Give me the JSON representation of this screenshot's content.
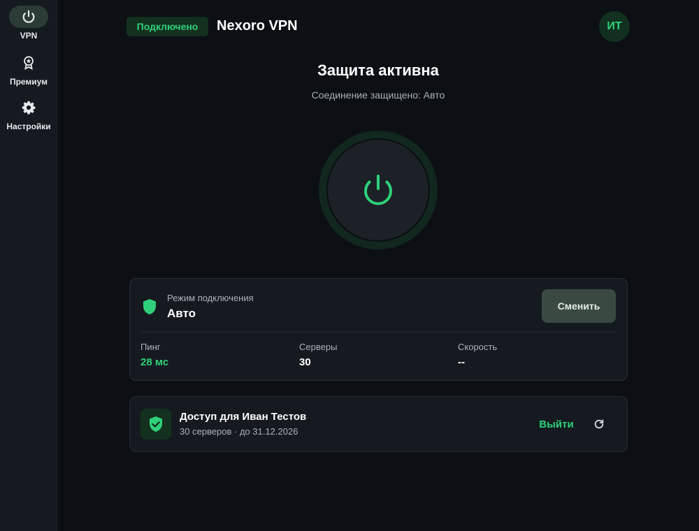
{
  "sidebar": {
    "items": [
      {
        "label": "VPN",
        "icon": "power-icon",
        "active": true
      },
      {
        "label": "Премиум",
        "icon": "award-icon",
        "active": false
      },
      {
        "label": "Настройки",
        "icon": "gear-icon",
        "active": false
      }
    ]
  },
  "header": {
    "status": "Подключено",
    "title": "Nexoro VPN",
    "avatar_initials": "ИТ"
  },
  "hero": {
    "title": "Защита активна",
    "subtitle": "Соединение защищено: Авто",
    "power_icon": "power-icon"
  },
  "mode_card": {
    "caption": "Режим подключения",
    "value": "Авто",
    "change_label": "Сменить",
    "stats": [
      {
        "label": "Пинг",
        "value": "28 мс"
      },
      {
        "label": "Серверы",
        "value": "30"
      },
      {
        "label": "Скорость",
        "value": "--"
      }
    ]
  },
  "access_card": {
    "title": "Доступ для Иван Тестов",
    "subtitle": "30 серверов · до 31.12.2026",
    "logout_label": "Выйти",
    "refresh_icon": "refresh-icon"
  },
  "colors": {
    "accent": "#2fd07a",
    "background": "#0c1015",
    "sidebar": "#141a20",
    "card": "#151a20"
  }
}
